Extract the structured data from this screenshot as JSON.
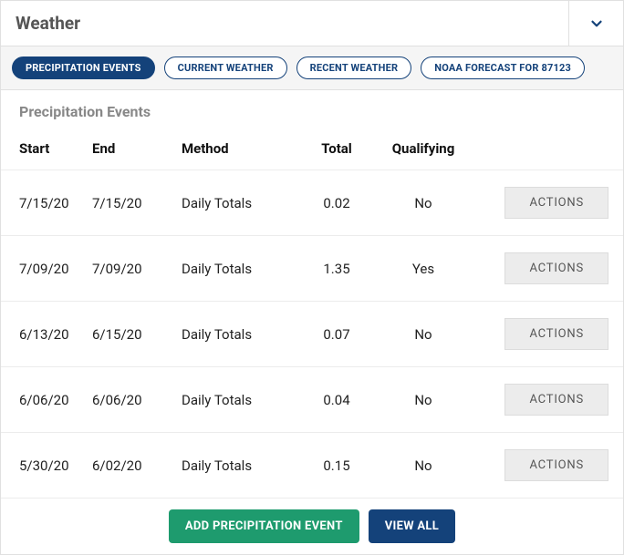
{
  "panel": {
    "title": "Weather"
  },
  "tabs": [
    {
      "label": "PRECIPITATION EVENTS",
      "active": true
    },
    {
      "label": "CURRENT WEATHER",
      "active": false
    },
    {
      "label": "RECENT WEATHER",
      "active": false
    },
    {
      "label": "NOAA FORECAST FOR 87123",
      "active": false
    }
  ],
  "section": {
    "title": "Precipitation Events"
  },
  "columns": {
    "start": "Start",
    "end": "End",
    "method": "Method",
    "total": "Total",
    "qualifying": "Qualifying"
  },
  "rows": [
    {
      "start": "7/15/20",
      "end": "7/15/20",
      "method": "Daily Totals",
      "total": "0.02",
      "qualifying": "No"
    },
    {
      "start": "7/09/20",
      "end": "7/09/20",
      "method": "Daily Totals",
      "total": "1.35",
      "qualifying": "Yes"
    },
    {
      "start": "6/13/20",
      "end": "6/15/20",
      "method": "Daily Totals",
      "total": "0.07",
      "qualifying": "No"
    },
    {
      "start": "6/06/20",
      "end": "6/06/20",
      "method": "Daily Totals",
      "total": "0.04",
      "qualifying": "No"
    },
    {
      "start": "5/30/20",
      "end": "6/02/20",
      "method": "Daily Totals",
      "total": "0.15",
      "qualifying": "No"
    }
  ],
  "actions_label": "ACTIONS",
  "footer": {
    "add_label": "ADD PRECIPITATION EVENT",
    "view_all_label": "VIEW ALL"
  },
  "colors": {
    "navy": "#14427a",
    "green": "#1e9b6e"
  }
}
